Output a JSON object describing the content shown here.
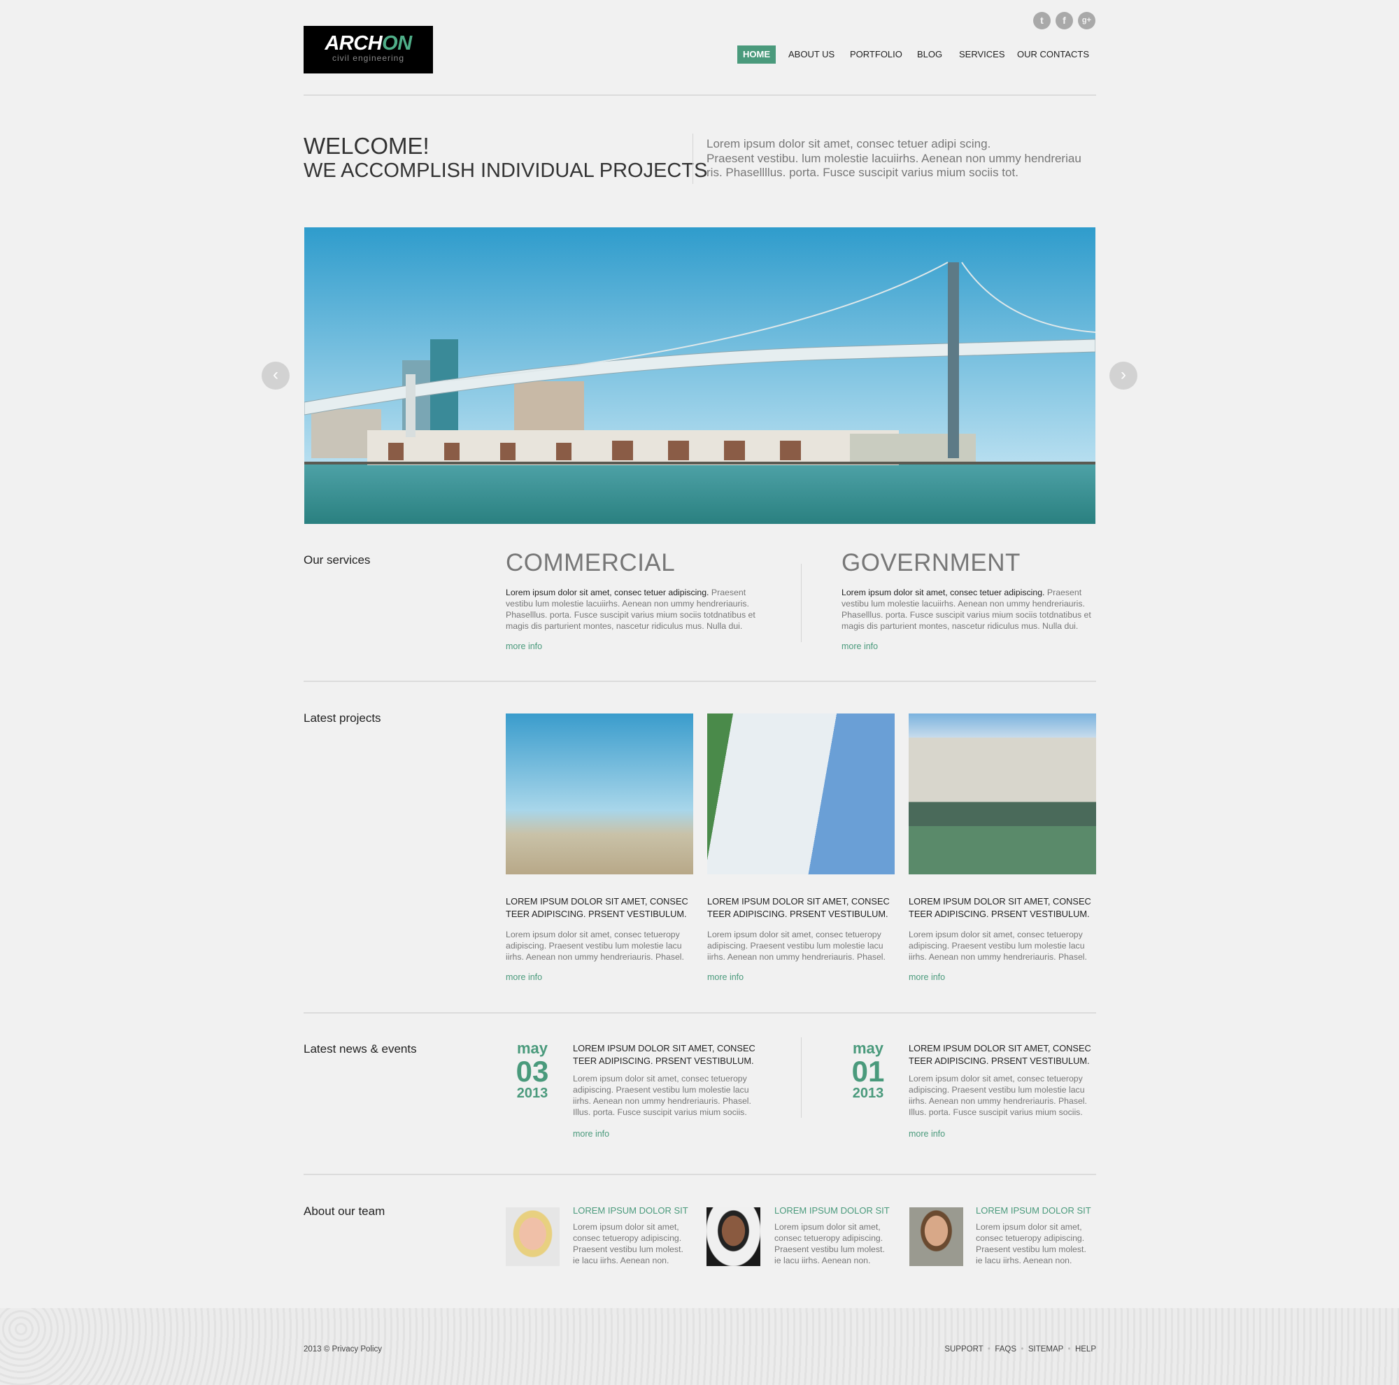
{
  "header": {
    "logo": {
      "text_white": "ARCH",
      "text_green": "ON",
      "tagline": "civil engineering"
    },
    "social": [
      {
        "icon": "twitter-icon",
        "glyph": "t"
      },
      {
        "icon": "facebook-icon",
        "glyph": "f"
      },
      {
        "icon": "google-plus-icon",
        "glyph": "g+"
      }
    ],
    "nav": [
      {
        "label": "HOME",
        "active": true
      },
      {
        "label": "ABOUT US"
      },
      {
        "label": "PORTFOLIO"
      },
      {
        "label": "BLOG"
      },
      {
        "label": "SERVICES"
      },
      {
        "label": "OUR CONTACTS"
      }
    ]
  },
  "welcome": {
    "title": "WELCOME!",
    "subtitle": "WE ACCOMPLISH INDIVIDUAL PROJECTS",
    "text_lines": [
      "Lorem ipsum dolor sit amet, consec tetuer adipi scing.",
      "Praesent vestibu.  lum molestie lacuiirhs. Aenean non ummy hendreriau",
      "ris. Phasellllus. porta. Fusce suscipit varius mium sociis tot."
    ]
  },
  "slider": {
    "prev": "‹",
    "next": "›"
  },
  "services": {
    "label": "Our services",
    "items": [
      {
        "title": "COMMERCIAL",
        "lead": "Lorem ipsum dolor sit amet, consec tetuer adipiscing.",
        "text": " Praesent vestibu lum molestie lacuiirhs. Aenean non ummy hendreriauris. Phaselllus. porta. Fusce suscipit varius mium sociis totdnatibus et magis dis parturient montes, nascetur ridiculus mus. Nulla dui.",
        "more": "more info"
      },
      {
        "title": "GOVERNMENT",
        "lead": "Lorem ipsum dolor sit amet, consec tetuer adipiscing.",
        "text": " Praesent vestibu lum molestie lacuiirhs. Aenean non ummy hendreriauris. Phaselllus. porta. Fusce suscipit varius mium sociis totdnatibus et magis dis parturient montes, nascetur ridiculus mus. Nulla dui.",
        "more": "more info"
      }
    ]
  },
  "projects": {
    "label": "Latest projects",
    "items": [
      {
        "title": "LOREM IPSUM DOLOR SIT AMET, CONSEC TEER ADIPISCING. PRSENT VESTIBULUM.",
        "text": "Lorem ipsum dolor sit amet, consec tetueropy adipiscing. Praesent vestibu lum molestie lacu iirhs. Aenean non ummy hendreriauris. Phasel.",
        "more": "more info"
      },
      {
        "title": "LOREM IPSUM DOLOR SIT AMET, CONSEC TEER ADIPISCING. PRSENT VESTIBULUM.",
        "text": "Lorem ipsum dolor sit amet, consec tetueropy adipiscing. Praesent vestibu lum molestie lacu iirhs. Aenean non ummy hendreriauris. Phasel.",
        "more": "more info"
      },
      {
        "title": "LOREM IPSUM DOLOR SIT AMET, CONSEC TEER ADIPISCING. PRSENT VESTIBULUM.",
        "text": "Lorem ipsum dolor sit amet, consec tetueropy adipiscing. Praesent vestibu lum molestie lacu iirhs. Aenean non ummy hendreriauris. Phasel.",
        "more": "more info"
      }
    ]
  },
  "news": {
    "label": "Latest news & events",
    "items": [
      {
        "month": "may",
        "day": "03",
        "year": "2013",
        "title": "LOREM IPSUM DOLOR SIT AMET, CONSEC TEER ADIPISCING. PRSENT VESTIBULUM.",
        "text": "Lorem ipsum dolor sit amet, consec tetueropy adipiscing. Praesent vestibu lum molestie lacu iirhs. Aenean non ummy hendreriauris. Phasel. Illus. porta. Fusce suscipit varius mium sociis.",
        "more": "more info"
      },
      {
        "month": "may",
        "day": "01",
        "year": "2013",
        "title": "LOREM IPSUM DOLOR SIT AMET, CONSEC TEER ADIPISCING. PRSENT VESTIBULUM.",
        "text": "Lorem ipsum dolor sit amet, consec tetueropy adipiscing. Praesent vestibu lum molestie lacu iirhs. Aenean non ummy hendreriauris. Phasel. Illus. porta. Fusce suscipit varius mium sociis.",
        "more": "more info"
      }
    ]
  },
  "team": {
    "label": "About our team",
    "members": [
      {
        "title": "LOREM IPSUM DOLOR SIT",
        "text": "Lorem ipsum dolor sit amet, consec tetueropy adipiscing. Praesent vestibu lum molest. ie lacu iirhs. Aenean non."
      },
      {
        "title": "LOREM IPSUM DOLOR SIT",
        "text": "Lorem ipsum dolor sit amet, consec tetueropy adipiscing. Praesent vestibu lum molest. ie lacu iirhs. Aenean non."
      },
      {
        "title": "LOREM IPSUM DOLOR SIT",
        "text": "Lorem ipsum dolor sit amet, consec tetueropy adipiscing. Praesent vestibu lum molest. ie lacu iirhs. Aenean non."
      }
    ]
  },
  "footer": {
    "copyright": "2013 © Privacy Policy",
    "links": [
      "SUPPORT",
      "FAQS",
      "SITEMAP",
      "HELP"
    ]
  },
  "colors": {
    "accent": "#4a9a7c",
    "background": "#f1f1f1"
  }
}
